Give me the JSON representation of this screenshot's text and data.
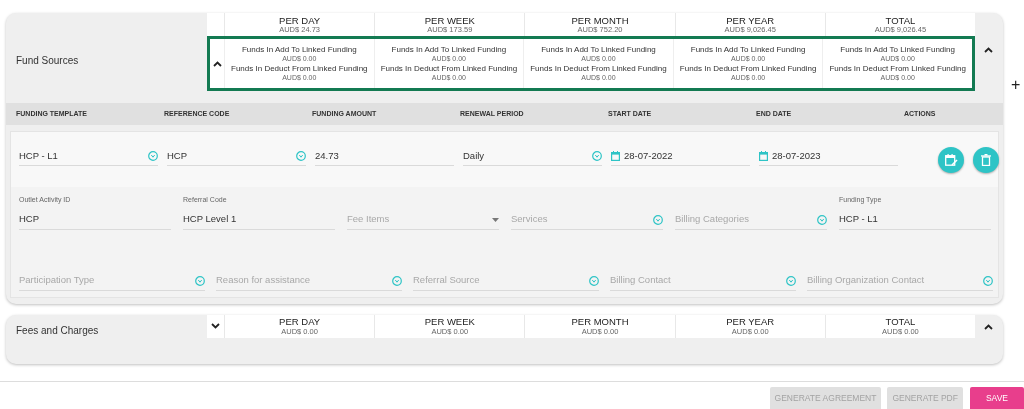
{
  "sections": [
    {
      "title": "Fund Sources",
      "expanded": true,
      "linked_expanded": true,
      "summary": [
        {
          "label": "PER DAY",
          "amount": "AUD$ 24.73",
          "linked": [
            {
              "label": "Funds In Add To Linked Funding",
              "amount": "AUD$ 0.00"
            },
            {
              "label": "Funds In Deduct From Linked Funding",
              "amount": "AUD$ 0.00"
            }
          ]
        },
        {
          "label": "PER WEEK",
          "amount": "AUD$ 173.59",
          "linked": [
            {
              "label": "Funds In Add To Linked Funding",
              "amount": "AUD$ 0.00"
            },
            {
              "label": "Funds In Deduct From Linked Funding",
              "amount": "AUD$ 0.00"
            }
          ]
        },
        {
          "label": "PER MONTH",
          "amount": "AUD$ 752.20",
          "linked": [
            {
              "label": "Funds In Add To Linked Funding",
              "amount": "AUD$ 0.00"
            },
            {
              "label": "Funds In Deduct From Linked Funding",
              "amount": "AUD$ 0.00"
            }
          ]
        },
        {
          "label": "PER YEAR",
          "amount": "AUD$ 9,026.45",
          "linked": [
            {
              "label": "Funds In Add To Linked Funding",
              "amount": "AUD$ 0.00"
            },
            {
              "label": "Funds In Deduct From Linked Funding",
              "amount": "AUD$ 0.00"
            }
          ]
        },
        {
          "label": "TOTAL",
          "amount": "AUD$ 9,026.45",
          "linked": [
            {
              "label": "Funds In Add To Linked Funding",
              "amount": "AUD$ 0.00"
            },
            {
              "label": "Funds In Deduct From Linked Funding",
              "amount": "AUD$ 0.00"
            }
          ]
        }
      ],
      "columns": [
        "FUNDING TEMPLATE",
        "REFERENCE CODE",
        "FUNDING AMOUNT",
        "RENEWAL PERIOD",
        "START DATE",
        "END DATE",
        "ACTIONS"
      ],
      "row": [
        {
          "kind": "dropdown",
          "value": "HCP - L1"
        },
        {
          "kind": "dropdown",
          "value": "HCP"
        },
        {
          "kind": "text",
          "value": "24.73"
        },
        {
          "kind": "dropdown",
          "value": "Daily"
        },
        {
          "kind": "date",
          "value": "28-07-2022"
        },
        {
          "kind": "date",
          "value": "28-07-2023"
        }
      ],
      "actions": [
        {
          "kind": "schedule"
        },
        {
          "kind": "delete"
        }
      ],
      "details": [
        {
          "kind": "text",
          "label": "Outlet Activity ID",
          "value": "HCP"
        },
        {
          "kind": "text",
          "label": "Referral Code",
          "value": "HCP Level 1"
        },
        {
          "kind": "select",
          "placeholder": "Fee Items"
        },
        {
          "kind": "dropdown",
          "placeholder": "Services"
        },
        {
          "kind": "dropdown",
          "placeholder": "Billing Categories"
        },
        {
          "kind": "text",
          "label": "Funding Type",
          "value": "HCP - L1"
        }
      ],
      "extra": [
        {
          "kind": "dropdown",
          "placeholder": "Participation Type"
        },
        {
          "kind": "dropdown",
          "placeholder": "Reason for assistance"
        },
        {
          "kind": "dropdown",
          "placeholder": "Referral Source"
        },
        {
          "kind": "dropdown",
          "placeholder": "Billing Contact"
        },
        {
          "kind": "dropdown",
          "placeholder": "Billing Organization Contact"
        }
      ]
    },
    {
      "title": "Fees and Charges",
      "expanded": true,
      "linked_expanded": false,
      "summary": [
        {
          "label": "PER DAY",
          "amount": "AUD$ 0.00"
        },
        {
          "label": "PER WEEK",
          "amount": "AUD$ 0.00"
        },
        {
          "label": "PER MONTH",
          "amount": "AUD$ 0.00"
        },
        {
          "label": "PER YEAR",
          "amount": "AUD$ 0.00"
        },
        {
          "label": "TOTAL",
          "amount": "AUD$ 0.00"
        }
      ]
    }
  ],
  "add_symbol": "+",
  "footer_buttons": [
    {
      "label": "GENERATE AGREEMENT",
      "kind": "secondary",
      "disabled": true
    },
    {
      "label": "GENERATE PDF",
      "kind": "secondary",
      "disabled": true
    },
    {
      "label": "SAVE",
      "kind": "primary",
      "disabled": false
    }
  ]
}
